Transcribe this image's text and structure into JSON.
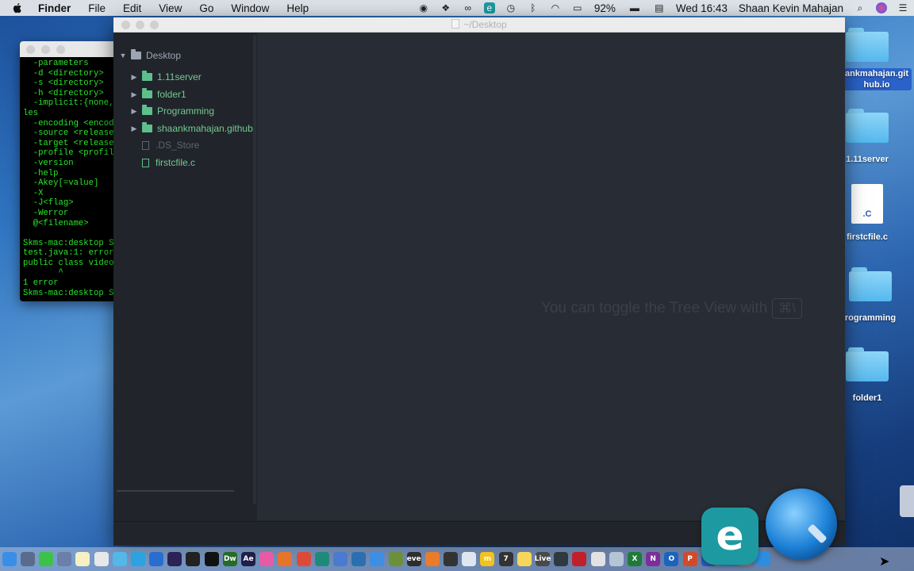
{
  "menubar": {
    "app_name": "Finder",
    "menus": [
      "File",
      "Edit",
      "View",
      "Go",
      "Window",
      "Help"
    ],
    "battery": "92%",
    "clock": "Wed 16:43",
    "user": "Shaan Kevin Mahajan",
    "status_icons": [
      "record-icon",
      "dropbox-icon",
      "creative-cloud-icon",
      "eset-icon",
      "time-machine-icon",
      "bluetooth-icon",
      "wifi-icon",
      "airplay-icon",
      "battery-icon",
      "input-source-icon"
    ]
  },
  "terminal": {
    "lines": [
      "  -parameters",
      "  -d <directory>",
      "  -s <directory>",
      "  -h <directory>",
      "  -implicit:{none,",
      "les",
      "  -encoding <encod",
      "  -source <release",
      "  -target <release",
      "  -profile <profil",
      "  -version",
      "  -help",
      "  -Akey[=value]",
      "  -X",
      "  -J<flag>",
      "  -Werror",
      "  @<filename>",
      "",
      "Skms-mac:desktop S",
      "test.java:1: error",
      "public class video",
      "       ^",
      "1 error",
      "Skms-mac:desktop S"
    ]
  },
  "atom": {
    "title": "~/Desktop",
    "tree": {
      "root": "Desktop",
      "items": [
        {
          "label": "1.11server",
          "type": "folder"
        },
        {
          "label": "folder1",
          "type": "folder"
        },
        {
          "label": "Programming",
          "type": "folder"
        },
        {
          "label": "shaankmahajan.github.",
          "type": "folder"
        },
        {
          "label": ".DS_Store",
          "type": "file-ignored"
        },
        {
          "label": "firstcfile.c",
          "type": "file"
        }
      ]
    },
    "hint_text": "You can toggle the Tree View with",
    "hint_key": "⌘\\"
  },
  "desktop": {
    "icons": [
      {
        "label": "ankmahajan.git hub.io",
        "kind": "folder",
        "selected": true
      },
      {
        "label": "1.11server",
        "kind": "folder"
      },
      {
        "label": "firstcfile.c",
        "kind": "file",
        "badge": ".C"
      },
      {
        "label": "rogramming",
        "kind": "folder"
      },
      {
        "label": "folder1",
        "kind": "folder"
      }
    ]
  },
  "dock": {
    "apps": [
      {
        "name": "finder-icon",
        "color": "#3a8ee6"
      },
      {
        "name": "launchpad-icon",
        "color": "#5a6b8c"
      },
      {
        "name": "messages-icon",
        "color": "#3cc24a"
      },
      {
        "name": "mission-control-icon",
        "color": "#6c7fa8"
      },
      {
        "name": "notes-icon",
        "color": "#f5f1c4"
      },
      {
        "name": "photos-icon",
        "color": "#e8e8e8"
      },
      {
        "name": "maps-icon",
        "color": "#53b7e8"
      },
      {
        "name": "safari-icon",
        "color": "#2aa3e0"
      },
      {
        "name": "visual-studio-icon",
        "color": "#2a6dd0"
      },
      {
        "name": "eclipse-icon",
        "color": "#2c2255"
      },
      {
        "name": "terminal-icon",
        "color": "#222222"
      },
      {
        "name": "terminal-2-icon",
        "color": "#111111"
      },
      {
        "name": "dreamweaver-icon",
        "color": "#256b2a",
        "text": "Dw"
      },
      {
        "name": "after-effects-icon",
        "color": "#1f1f4a",
        "text": "Ae"
      },
      {
        "name": "itunes-icon",
        "color": "#e75ba6"
      },
      {
        "name": "firefox-icon",
        "color": "#e6742a"
      },
      {
        "name": "chrome-icon",
        "color": "#dc4b3a"
      },
      {
        "name": "utility-icon",
        "color": "#1f8a7a"
      },
      {
        "name": "chat-icon",
        "color": "#4b7bd0"
      },
      {
        "name": "network-icon",
        "color": "#2c6fb0"
      },
      {
        "name": "xcode-icon",
        "color": "#3e8ee3"
      },
      {
        "name": "minecraft-icon",
        "color": "#6e8f3a"
      },
      {
        "name": "evernote-icon",
        "color": "#2e2e2e",
        "text": "eve"
      },
      {
        "name": "blender-icon",
        "color": "#e97b2b"
      },
      {
        "name": "app-icon",
        "color": "#333333"
      },
      {
        "name": "preview-icon",
        "color": "#dfe6f0"
      },
      {
        "name": "app-m-icon",
        "color": "#f2c21d",
        "text": "m"
      },
      {
        "name": "app-7-icon",
        "color": "#333333",
        "text": "7"
      },
      {
        "name": "notes-yellow-icon",
        "color": "#f6d65a"
      },
      {
        "name": "ableton-live-icon",
        "color": "#4a4a4a",
        "text": "Live"
      },
      {
        "name": "app-dark-icon",
        "color": "#2f3a40"
      },
      {
        "name": "radio-icon",
        "color": "#c0202a"
      },
      {
        "name": "image-icon",
        "color": "#e2e2e2"
      },
      {
        "name": "sketch-icon",
        "color": "#b6c4d8"
      },
      {
        "name": "excel-icon",
        "color": "#1f7a3a",
        "text": "X"
      },
      {
        "name": "onenote-icon",
        "color": "#7a2f9a",
        "text": "N"
      },
      {
        "name": "outlook-icon",
        "color": "#1a64c0",
        "text": "O"
      },
      {
        "name": "powerpoint-icon",
        "color": "#d14a2a",
        "text": "P"
      },
      {
        "name": "word-icon",
        "color": "#2b5cb8",
        "text": "W"
      },
      {
        "name": "app-store-icon",
        "color": "#2f8de4"
      },
      {
        "name": "system-preferences-icon",
        "color": "#8a8a8a"
      },
      {
        "name": "dropbox-icon",
        "color": "#2d8de0"
      }
    ],
    "eset_letter": "e"
  }
}
